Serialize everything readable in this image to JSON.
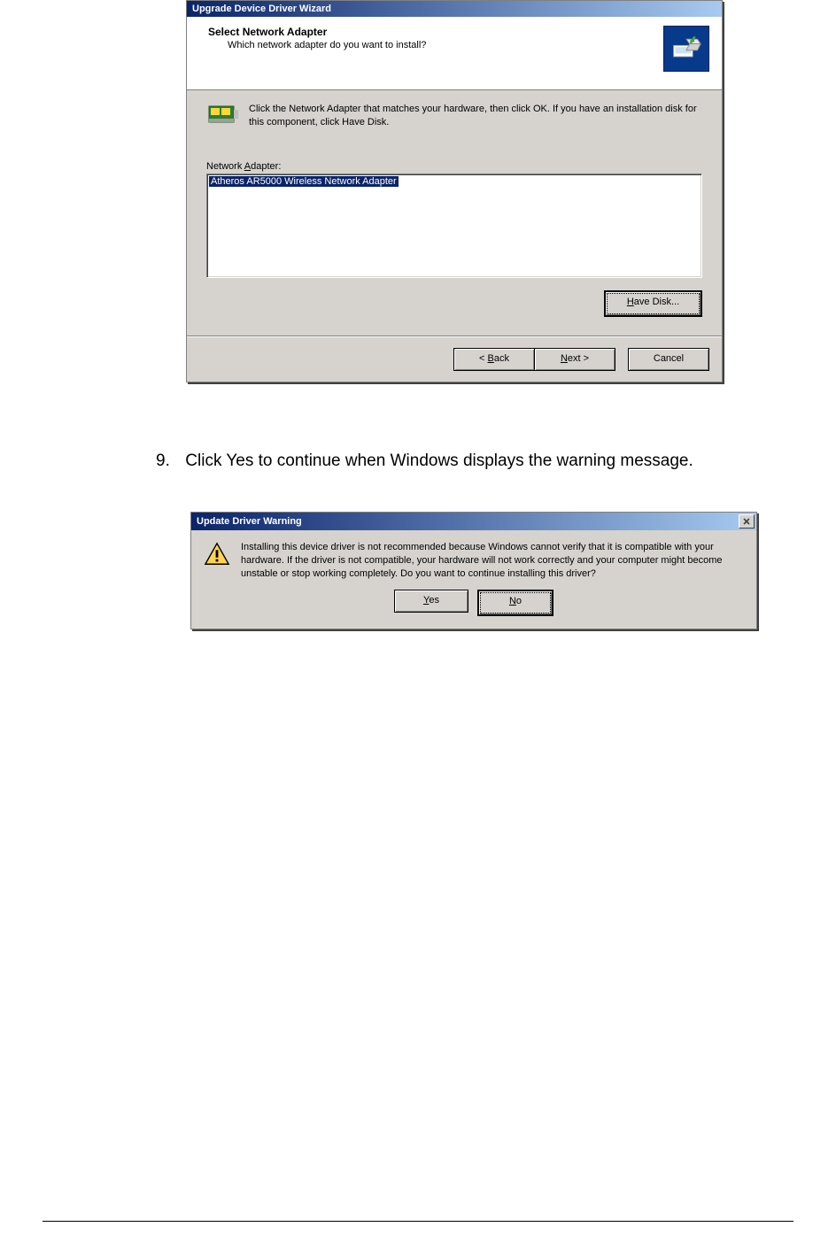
{
  "wizard": {
    "title": "Upgrade Device Driver Wizard",
    "header_title": "Select Network Adapter",
    "header_sub": "Which network adapter do you want to install?",
    "instruction": "Click the Network Adapter that matches your hardware, then click OK. If you have an installation disk for this component, click Have Disk.",
    "list_label_pre": "Network ",
    "list_label_ul": "A",
    "list_label_post": "dapter:",
    "adapters": [
      "Atheros AR5000 Wireless Network Adapter"
    ],
    "have_disk_ul": "H",
    "have_disk_post": "ave Disk...",
    "back_pre": "< ",
    "back_ul": "B",
    "back_post": "ack",
    "next_ul": "N",
    "next_post": "ext >",
    "cancel": "Cancel"
  },
  "step": {
    "number": "9.",
    "text": "Click Yes to continue when Windows displays the warning message."
  },
  "warning": {
    "title": "Update Driver Warning",
    "body": "Installing this device driver is not recommended because Windows cannot verify that it is compatible with your hardware.  If the driver is not compatible, your hardware will not work correctly and your computer might become unstable or stop working completely.  Do you want to continue installing this driver?",
    "yes_ul": "Y",
    "yes_post": "es",
    "no_ul": "N",
    "no_post": "o"
  }
}
